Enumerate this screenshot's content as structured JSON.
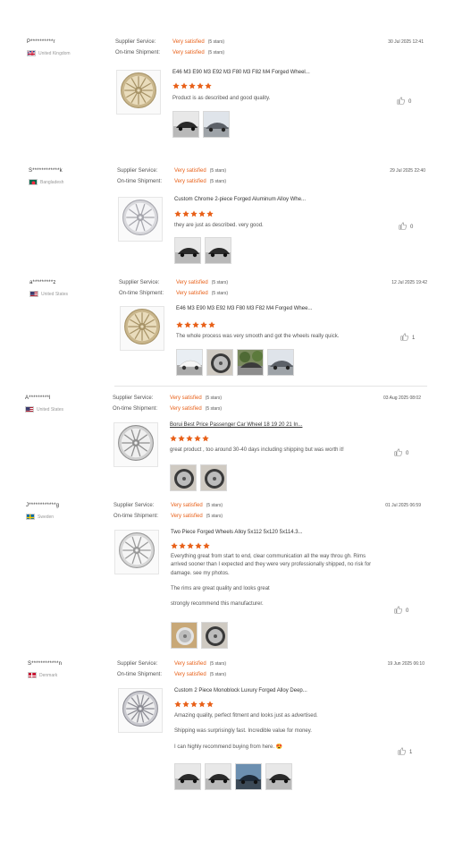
{
  "labels": {
    "supplier_service": "Supplier Service:",
    "on_time_shipment": "On-time Shipment:"
  },
  "colors": {
    "accent": "#e8611a",
    "divider": "#e4e4e4"
  },
  "reviews": [
    {
      "user": "P**********r",
      "country": "United Kingdom",
      "flag": "uk",
      "date": "30 Jul 2025 12:41",
      "supplier_value": "Very satisfied",
      "supplier_stars": "(5 stars)",
      "shipment_value": "Very satisfied",
      "shipment_stars": "(5 stars)",
      "product_title": "E46 M3 E90 M3 E92 M3 F80 M3 F82 M4 Forged Wheel...",
      "product_icon": "gold-wheel-icon",
      "rating": 5,
      "comment": [
        "Product is as described and good quality."
      ],
      "likes": "0",
      "photos": [
        "black-car-photo",
        "grey-car-photo"
      ]
    },
    {
      "user": "S************k",
      "country": "Bangladesh",
      "flag": "bd",
      "date": "29 Jul 2025 22:40",
      "supplier_value": "Very satisfied",
      "supplier_stars": "(5 stars)",
      "shipment_value": "Very satisfied",
      "shipment_stars": "(5 stars)",
      "product_title": "Custom Chrome 2-piece Forged Aluminum Alloy Whe...",
      "product_icon": "chrome-wheel-icon",
      "rating": 5,
      "comment": [
        "they are just as described. very good."
      ],
      "likes": "0",
      "photos": [
        "black-car-photo",
        "black-car-photo"
      ]
    },
    {
      "user": "a*********z",
      "country": "United States",
      "flag": "us",
      "date": "12 Jul 2025 19:42",
      "supplier_value": "Very satisfied",
      "supplier_stars": "(5 stars)",
      "shipment_value": "Very satisfied",
      "shipment_stars": "(5 stars)",
      "product_title": "E46 M3 E90 M3 E92 M3 F80 M3 F82 M4 Forged Whee...",
      "product_icon": "gold-wheel-icon",
      "rating": 5,
      "comment": [
        "The whole process was very smooth and got the wheels really quick."
      ],
      "likes": "1",
      "photos": [
        "white-car-photo",
        "wheel-photo",
        "tree-car-photo",
        "grey-car-photo"
      ]
    },
    {
      "user": "A*********l",
      "country": "United States",
      "flag": "us",
      "date": "03 Aug 2025 08:02",
      "supplier_value": "Very satisfied",
      "supplier_stars": "(5 stars)",
      "shipment_value": "Very satisfied",
      "shipment_stars": "(5 stars)",
      "product_title": "Borui Best Price Passenger Car Wheel 18 19 20 21 In...",
      "product_icon": "silver-wheel-icon",
      "rating": 5,
      "comment": [
        "great product , too around 30-40 days including shipping but was worth it!"
      ],
      "likes": "0",
      "photos": [
        "wheel-photo",
        "wheel-photo"
      ]
    },
    {
      "user": "J************g",
      "country": "Sweden",
      "flag": "se",
      "date": "01 Jul 2025 06:59",
      "supplier_value": "Very satisfied",
      "supplier_stars": "(5 stars)",
      "shipment_value": "Very satisfied",
      "shipment_stars": "(5 stars)",
      "product_title": "Two Piece Forged Wheels Alloy 5x112 5x120 5x114.3...",
      "product_icon": "deep-dish-wheel-icon",
      "rating": 5,
      "comment": [
        "Everything great from start to end, clear communication all the way throu gh. Rims arrived sooner than I expected and they were very professionally shipped, no risk for damage. see my photos.",
        "The rims are great quality and looks great",
        "strongly recommend this manufacturer."
      ],
      "likes": "0",
      "photos": [
        "wheel-box-photo",
        "wheel-photo"
      ]
    },
    {
      "user": "S************n",
      "country": "Denmark",
      "flag": "dk",
      "date": "19 Jun 2025 06:10",
      "supplier_value": "Very satisfied",
      "supplier_stars": "(5 stars)",
      "shipment_value": "Very satisfied",
      "shipment_stars": "(5 stars)",
      "product_title": "Custom 2 Piece Monoblock Luxury Forged Alloy Deep...",
      "product_icon": "mesh-wheel-icon",
      "rating": 5,
      "comment": [
        "Amazing quality, perfect fitment and looks just as advertised.",
        "Shipping was surprisingly fast. Incredible value for money.",
        "I can highly recommend buying from here. 😍"
      ],
      "likes": "1",
      "photos": [
        "black-car-photo",
        "black-car-photo",
        "blue-car-photo",
        "black-car-photo"
      ]
    }
  ]
}
